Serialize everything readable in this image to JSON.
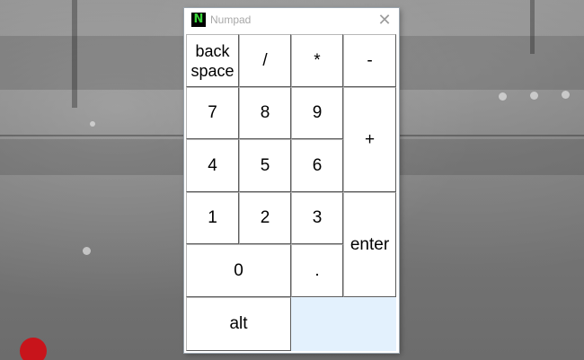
{
  "window": {
    "title": "Numpad",
    "icon_letter": "N",
    "close_symbol": "✕",
    "icon": "numpad-app-icon",
    "accent_color": "#39d339",
    "pad_background": "#e3f1fd"
  },
  "keys": {
    "backspace": "back space",
    "divide": "/",
    "multiply": "*",
    "minus": "-",
    "seven": "7",
    "eight": "8",
    "nine": "9",
    "plus": "+",
    "four": "4",
    "five": "5",
    "six": "6",
    "one": "1",
    "two": "2",
    "three": "3",
    "enter": "enter",
    "zero": "0",
    "decimal": ".",
    "alt": "alt"
  }
}
